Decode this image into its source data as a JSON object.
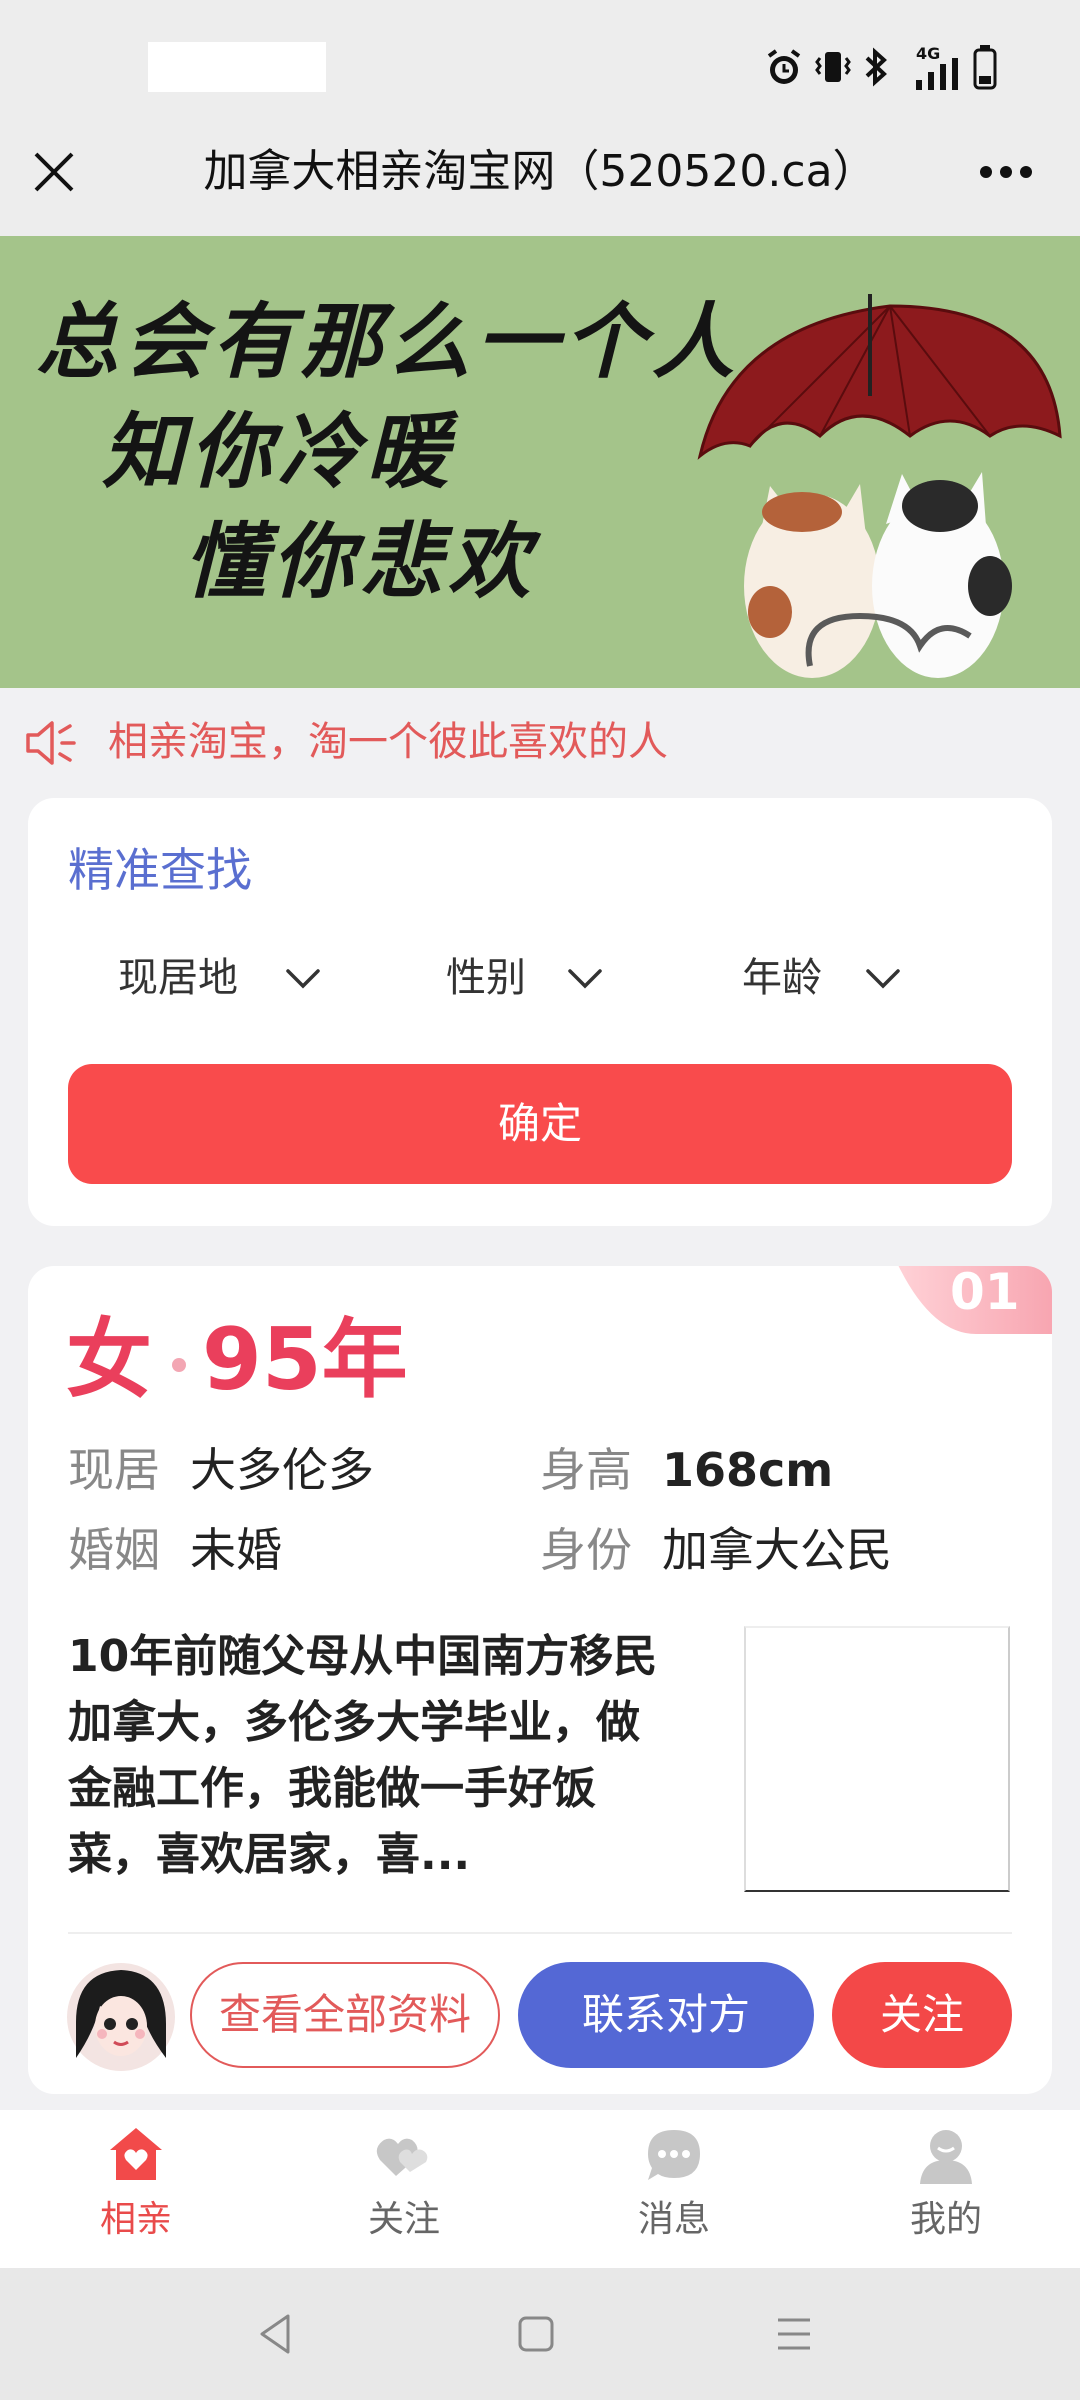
{
  "status_bar": {
    "icons": [
      "alarm-icon",
      "vibrate-icon",
      "bluetooth-icon",
      "signal-4g-icon",
      "battery-icon"
    ],
    "network_label": "4G"
  },
  "title_bar": {
    "title": "加拿大相亲淘宝网（520520.ca）"
  },
  "banner": {
    "line1": "总会有那么一个人",
    "line2": "知你冷暖",
    "line3": "懂你悲欢"
  },
  "notice": {
    "text": "相亲淘宝，淘一个彼此喜欢的人"
  },
  "search_card": {
    "title": "精准查找",
    "filters": [
      {
        "label": "现居地"
      },
      {
        "label": "性别"
      },
      {
        "label": "年龄"
      }
    ],
    "confirm_label": "确定"
  },
  "profile_card": {
    "badge": "01",
    "gender": "女",
    "year": "95年",
    "residence_key": "现居",
    "residence_val": "大多伦多",
    "height_key": "身高",
    "height_val": "168cm",
    "marital_key": "婚姻",
    "marital_val": "未婚",
    "status_key": "身份",
    "status_val": "加拿大公民",
    "description": "10年前随父母从中国南方移民加拿大，多伦多大学毕业，做金融工作，我能做一手好饭菜，喜欢居家，喜...",
    "view_all_label": "查看全部资料",
    "contact_label": "联系对方",
    "follow_label": "关注"
  },
  "tab_bar": {
    "tabs": [
      {
        "label": "相亲",
        "icon": "home-heart-icon",
        "active": true
      },
      {
        "label": "关注",
        "icon": "hearts-icon",
        "active": false
      },
      {
        "label": "消息",
        "icon": "chat-bubble-icon",
        "active": false
      },
      {
        "label": "我的",
        "icon": "user-icon",
        "active": false
      }
    ]
  },
  "colors": {
    "accent_red": "#f94b4c",
    "accent_blue": "#5468d5",
    "banner_green": "#a4c48a",
    "title_blue": "#5a6fd0",
    "gender_pink": "#ea3f5c"
  }
}
